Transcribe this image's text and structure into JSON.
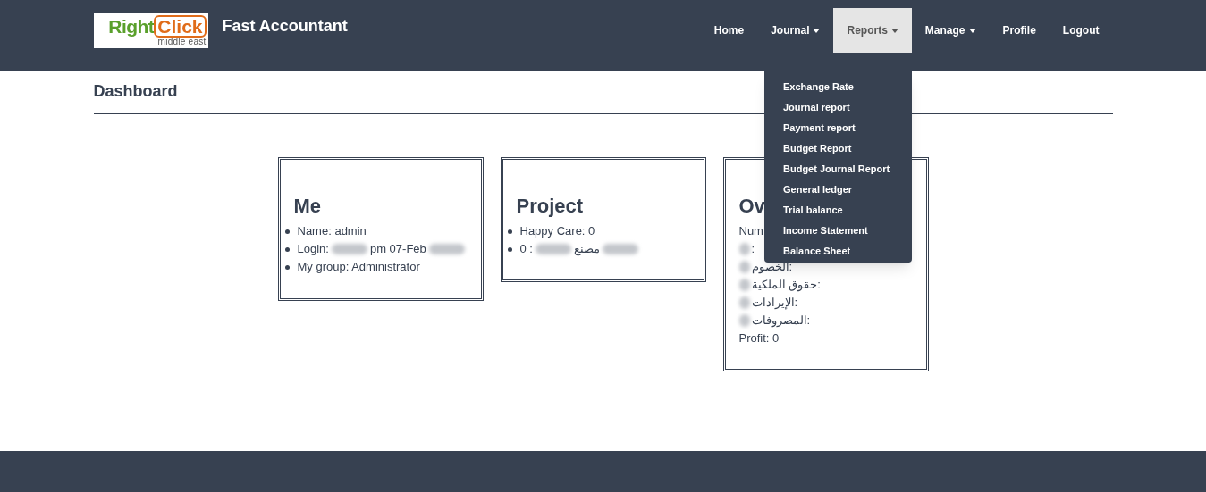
{
  "brand": {
    "logo_word_1": "Right",
    "logo_word_2": "Click",
    "logo_sub": "middle east",
    "title": "Fast Accountant"
  },
  "nav": [
    {
      "label": "Home",
      "dropdown": false,
      "selected": false
    },
    {
      "label": "Journal",
      "dropdown": true,
      "selected": false
    },
    {
      "label": "Reports",
      "dropdown": true,
      "selected": true
    },
    {
      "label": "Manage",
      "dropdown": true,
      "selected": false
    },
    {
      "label": "Profile",
      "dropdown": false,
      "selected": false
    },
    {
      "label": "Logout",
      "dropdown": false,
      "selected": false
    }
  ],
  "reports_menu": [
    "Exchange Rate",
    "Journal report",
    "Payment report",
    "Budget Report",
    "Budget Journal Report",
    "General ledger",
    "Trial balance",
    "Income Statement",
    "Balance Sheet"
  ],
  "page_title": "Dashboard",
  "cards": [
    {
      "title": "Me",
      "bullets": true,
      "items": [
        {
          "segments": [
            "Name: admin"
          ],
          "blurred": false
        },
        {
          "segments": [
            "Login:",
            "pm 07-Feb"
          ],
          "blurred": true
        },
        {
          "segments": [
            "My group: Administrator"
          ],
          "blurred": false
        }
      ]
    },
    {
      "title": "Project",
      "bullets": true,
      "items": [
        {
          "segments": [
            "Happy Care: 0"
          ],
          "blurred": false
        },
        {
          "segments": [
            "0 :",
            "مصنع"
          ],
          "blurred": true
        }
      ]
    },
    {
      "title": "Ov",
      "bullets": false,
      "items": [
        {
          "segments": [
            "Num"
          ],
          "blurred": false
        },
        {
          "segments": [
            ":"
          ],
          "blurred": true
        },
        {
          "segments": [
            "الخصوم:"
          ],
          "blurred": true
        },
        {
          "segments": [
            "حقوق الملكية:"
          ],
          "blurred": true
        },
        {
          "segments": [
            "الإيرادات:"
          ],
          "blurred": true
        },
        {
          "segments": [
            "المصروفات:"
          ],
          "blurred": true
        },
        {
          "segments": [
            "Profit: 0"
          ],
          "blurred": false
        }
      ]
    }
  ]
}
